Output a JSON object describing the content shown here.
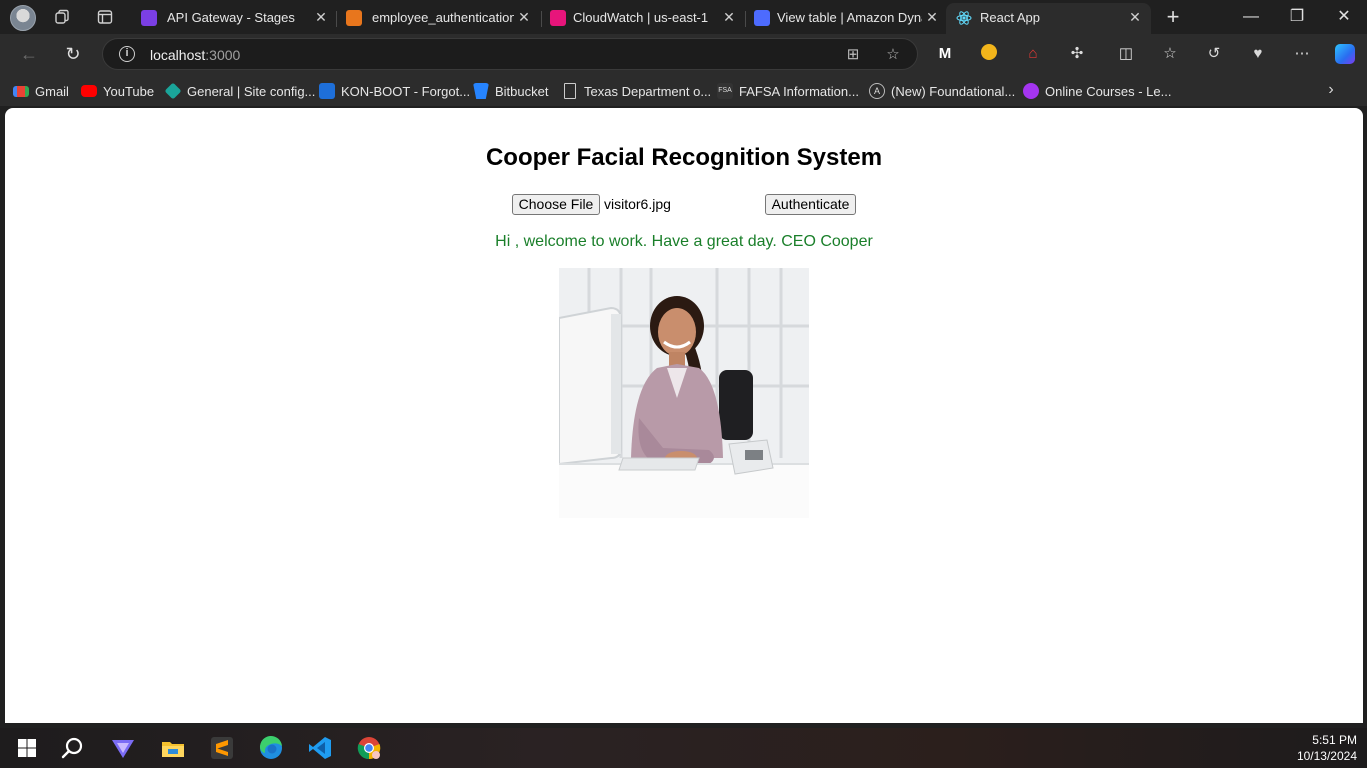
{
  "browser": {
    "tabs": [
      {
        "title": "API Gateway - Stages",
        "favicon": "api-gateway-icon",
        "color": "#7b3fe4"
      },
      {
        "title": "employee_authentication |",
        "favicon": "lambda-icon",
        "color": "#e8761d"
      },
      {
        "title": "CloudWatch | us-east-1",
        "favicon": "cloudwatch-icon",
        "color": "#e7157b"
      },
      {
        "title": "View table | Amazon Dynar",
        "favicon": "dynamodb-icon",
        "color": "#4d6bfe"
      },
      {
        "title": "React App",
        "favicon": "react-icon",
        "color": "#61dafb"
      }
    ],
    "address": {
      "host": "localhost",
      "port": ":3000"
    },
    "favorites": [
      {
        "label": "Gmail",
        "icon": "gmail-icon",
        "color": "#ea4335"
      },
      {
        "label": "YouTube",
        "icon": "youtube-icon",
        "color": "#ff0000"
      },
      {
        "label": "General | Site config...",
        "icon": "diamond-icon",
        "color": "#1aa59a"
      },
      {
        "label": "KON-BOOT - Forgot...",
        "icon": "konboot-icon",
        "color": "#1e6fd9"
      },
      {
        "label": "Bitbucket",
        "icon": "bitbucket-icon",
        "color": "#2684ff"
      },
      {
        "label": "Texas Department o...",
        "icon": "page-icon",
        "color": "#cccccc"
      },
      {
        "label": "FAFSA Information...",
        "icon": "fsa-icon",
        "color": "#333333"
      },
      {
        "label": "(New) Foundational...",
        "icon": "foundational-icon",
        "color": "#222222"
      },
      {
        "label": "Online Courses - Le...",
        "icon": "udemy-icon",
        "color": "#a435f0"
      }
    ]
  },
  "app": {
    "title": "Cooper Facial Recognition System",
    "choose_file_label": "Choose File",
    "file_name": "visitor6.jpg",
    "authenticate_label": "Authenticate",
    "welcome_message": "Hi , welcome to work. Have a great day. CEO Cooper",
    "photo_alt": "visitor photo"
  },
  "taskbar": {
    "time": "5:51 PM",
    "date": "10/13/2024"
  }
}
